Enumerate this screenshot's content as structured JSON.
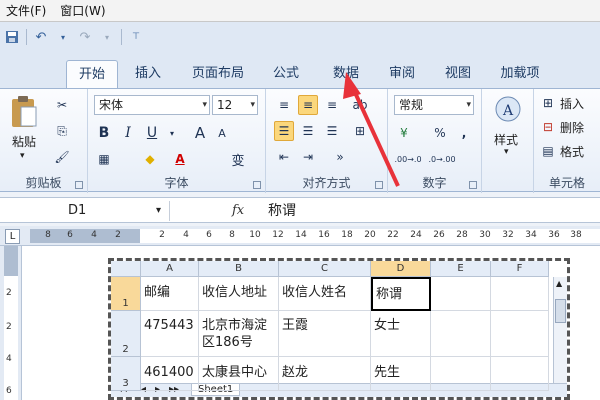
{
  "menu": {
    "items": [
      "文件(F)",
      "窗口(W)"
    ]
  },
  "tabs": [
    {
      "label": "开始",
      "active": true
    },
    {
      "label": "插入",
      "active": false
    },
    {
      "label": "页面布局",
      "active": false
    },
    {
      "label": "公式",
      "active": false
    },
    {
      "label": "数据",
      "active": false
    },
    {
      "label": "审阅",
      "active": false
    },
    {
      "label": "视图",
      "active": false
    },
    {
      "label": "加载项",
      "active": false
    }
  ],
  "ribbon": {
    "clipboard": {
      "paste_label": "粘贴",
      "group_label": "剪贴板"
    },
    "font": {
      "font_name": "宋体",
      "font_size": "12",
      "bold": "B",
      "italic": "I",
      "underline": "U",
      "grow": "A",
      "shrink": "A",
      "group_label": "字体",
      "phonetic": "wén"
    },
    "alignment": {
      "group_label": "对齐方式"
    },
    "number": {
      "format": "常规",
      "percent": "%",
      "comma": ",",
      "group_label": "数字",
      "dec_inc": ".00→.0",
      "dec_dec": ".0→.00"
    },
    "styles": {
      "label": "样式"
    },
    "cells": {
      "insert": "插入",
      "delete": "删除",
      "format": "格式",
      "group_label": "单元格"
    }
  },
  "formula_bar": {
    "name_box": "D1",
    "fx": "fx",
    "value": "称谓"
  },
  "ruler": {
    "numbers": [
      "8",
      "6",
      "4",
      "2",
      "2",
      "4",
      "6",
      "8",
      "10",
      "12",
      "14",
      "16",
      "18",
      "20",
      "22",
      "24",
      "26",
      "28",
      "30",
      "32",
      "34",
      "36",
      "38"
    ]
  },
  "vruler": {
    "numbers": [
      "2",
      "2",
      "4",
      "6"
    ]
  },
  "sheet": {
    "columns": [
      "A",
      "B",
      "C",
      "D",
      "E",
      "F"
    ],
    "rows": [
      "1",
      "2",
      "3"
    ],
    "selected_col": "D",
    "selected_row": "1",
    "cells": [
      [
        "邮编",
        "收信人地址",
        "收信人姓名",
        "称谓",
        "",
        ""
      ],
      [
        "475443",
        "北京市海淀区186号",
        "王霞",
        "女士",
        "",
        ""
      ],
      [
        "461400",
        "太康县中心小学",
        "赵龙",
        "先生",
        "",
        ""
      ]
    ],
    "sheet_tab": "Sheet1"
  },
  "accent": "#e8323a"
}
